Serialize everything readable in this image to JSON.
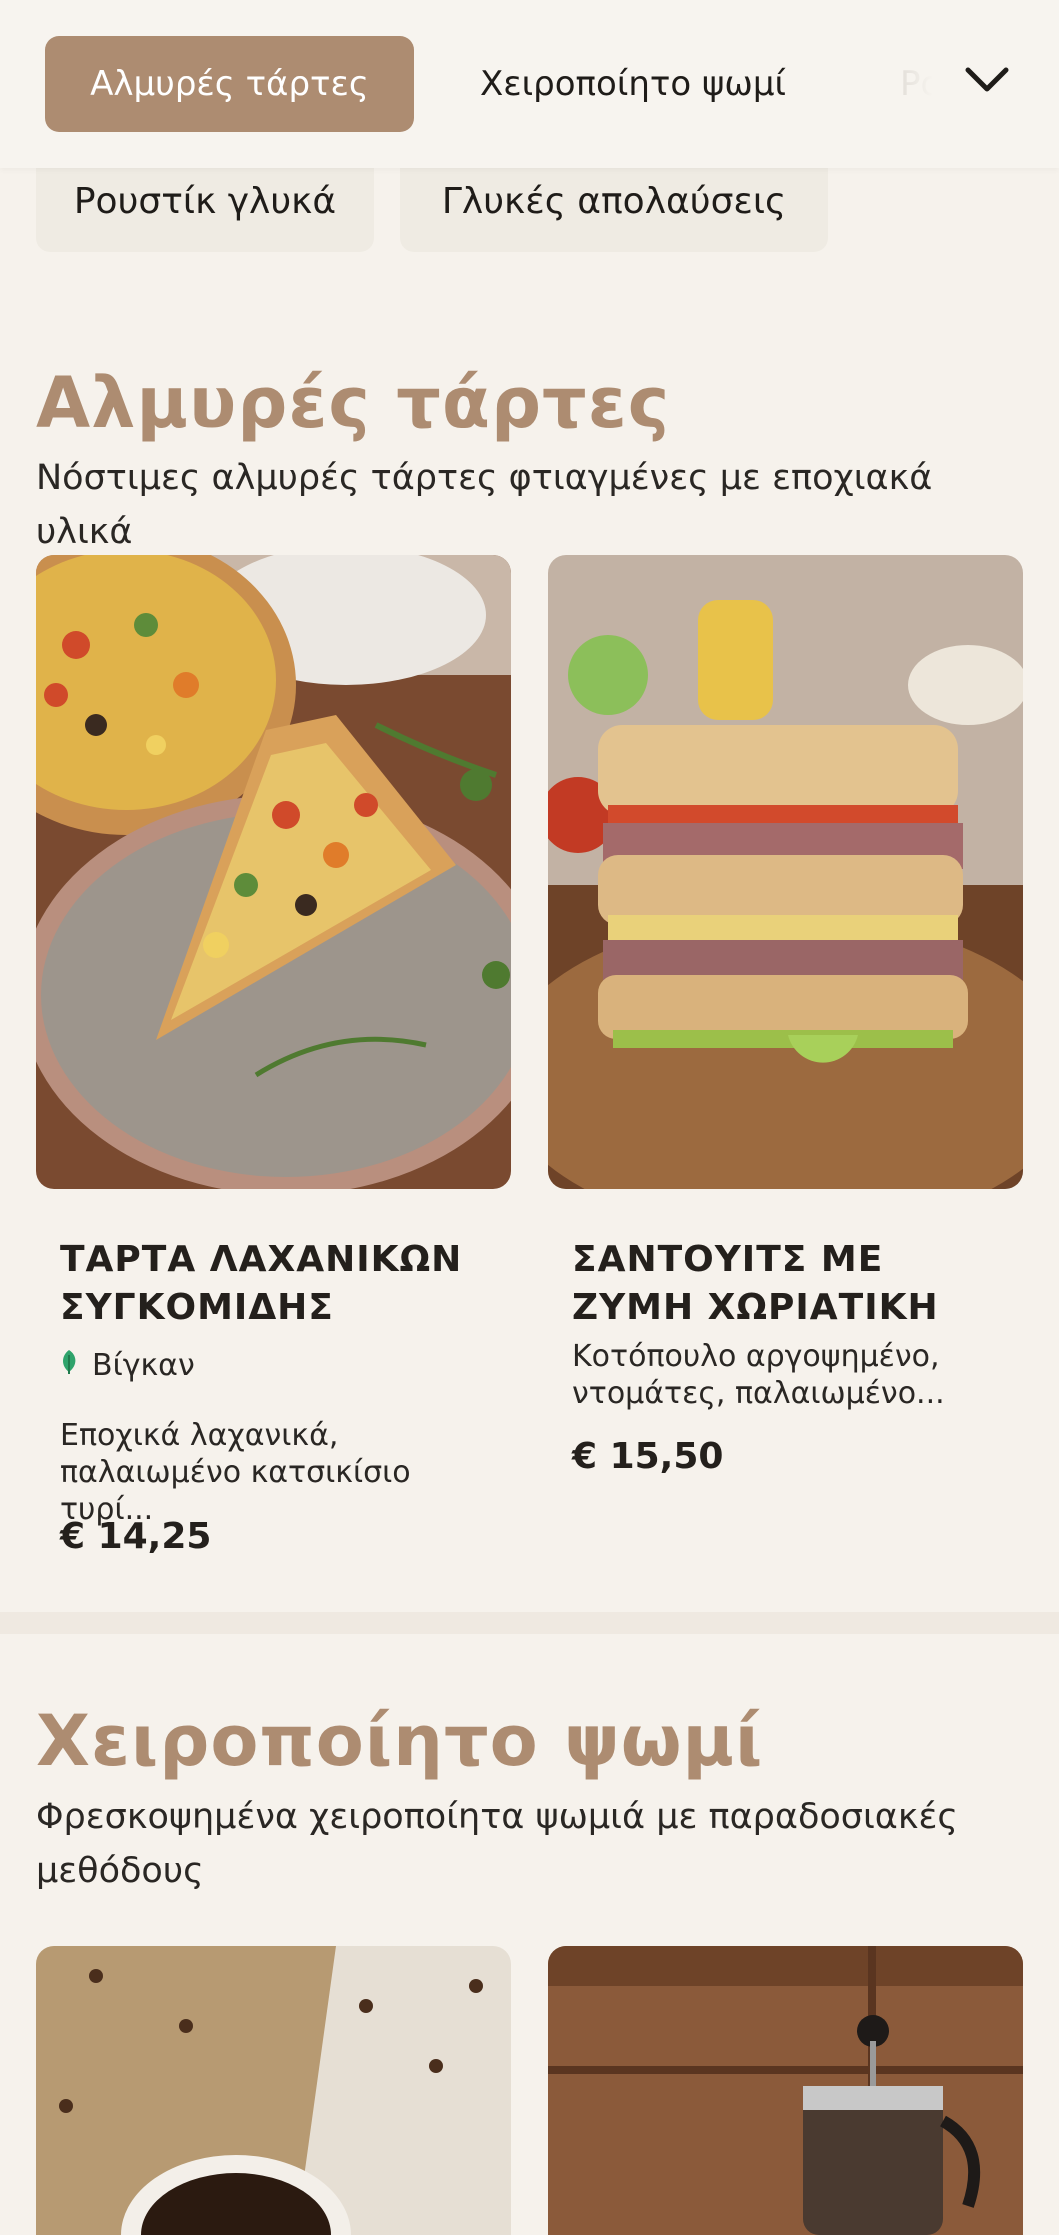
{
  "nav": {
    "active_category": "Αλμυρές τάρτες",
    "categories": [
      "Χειροποίητο ψωμί",
      "Ρουστίκ γλυκά",
      "Γλυκές απολαύσεις"
    ],
    "faded_category": "Ρο",
    "dropdown_icon": "chevron-down-icon"
  },
  "sections": [
    {
      "title": "Αλμυρές τάρτες",
      "description": "Νόστιμες αλμυρές τάρτες φτιαγμένες με εποχιακά υλικά",
      "items": [
        {
          "name": "ΤΑΡΤΑ ΛΑΧΑΝΙΚΩΝ ΣΥΓΚΟΜΙΔΗΣ",
          "tag": "Βίγκαν",
          "tag_icon": "leaf-icon",
          "description": "Εποχικά λαχανικά, παλαιωμένο κατσικίσιο τυρί...",
          "price": "€ 14,25"
        },
        {
          "name": "ΣΑΝΤΟΥΙΤΣ ΜΕ ΖΥΜΗ ΧΩΡΙΑΤΙΚΗ",
          "description": "Κοτόπουλο αργοψημένο, ντομάτες, παλαιωμένο...",
          "price": "€ 15,50"
        }
      ]
    },
    {
      "title": "Χειροποίητο ψωμί",
      "description": "Φρεσκοψημένα χειροποίητα ψωμιά με παραδοσιακές μεθόδους"
    }
  ],
  "colors": {
    "accent": "#ad8c71",
    "background": "#f6f2ec",
    "chip_background": "#efebe3",
    "vegan_green": "#2fa36b"
  }
}
